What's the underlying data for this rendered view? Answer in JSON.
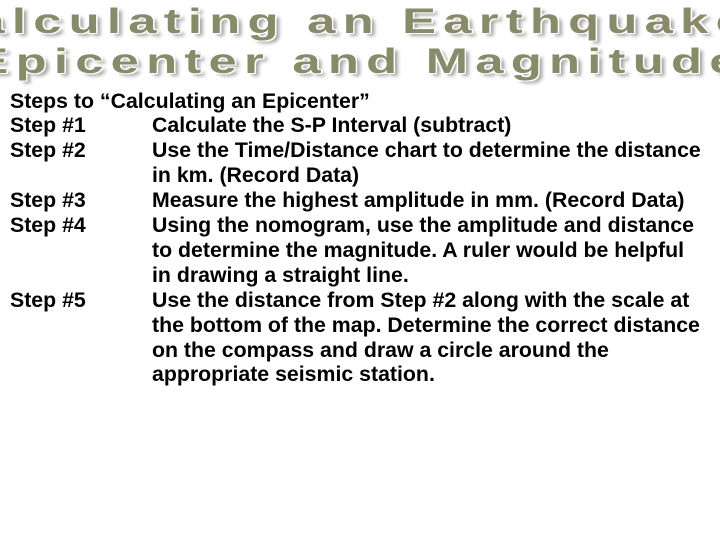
{
  "title": {
    "line1": "Calculating an Earthquakes",
    "line2": "Epicenter and Magnitude"
  },
  "heading": "Steps to “Calculating an Epicenter”",
  "steps": [
    {
      "label": "Step #1",
      "text": "Calculate the S-P Interval (subtract)"
    },
    {
      "label": "Step #2",
      "text": "Use the Time/Distance chart to determine the distance in km. (Record Data)"
    },
    {
      "label": "Step #3",
      "text": "Measure the highest amplitude in mm. (Record Data)"
    },
    {
      "label": "Step #4",
      "text": "Using the nomogram, use the amplitude and distance to determine the magnitude. A ruler would be helpful in drawing a straight line."
    },
    {
      "label": "Step #5",
      "text": "Use the distance from Step #2 along with the scale at the bottom of the map. Determine the correct distance on the compass and draw a circle around the appropriate seismic station."
    }
  ]
}
